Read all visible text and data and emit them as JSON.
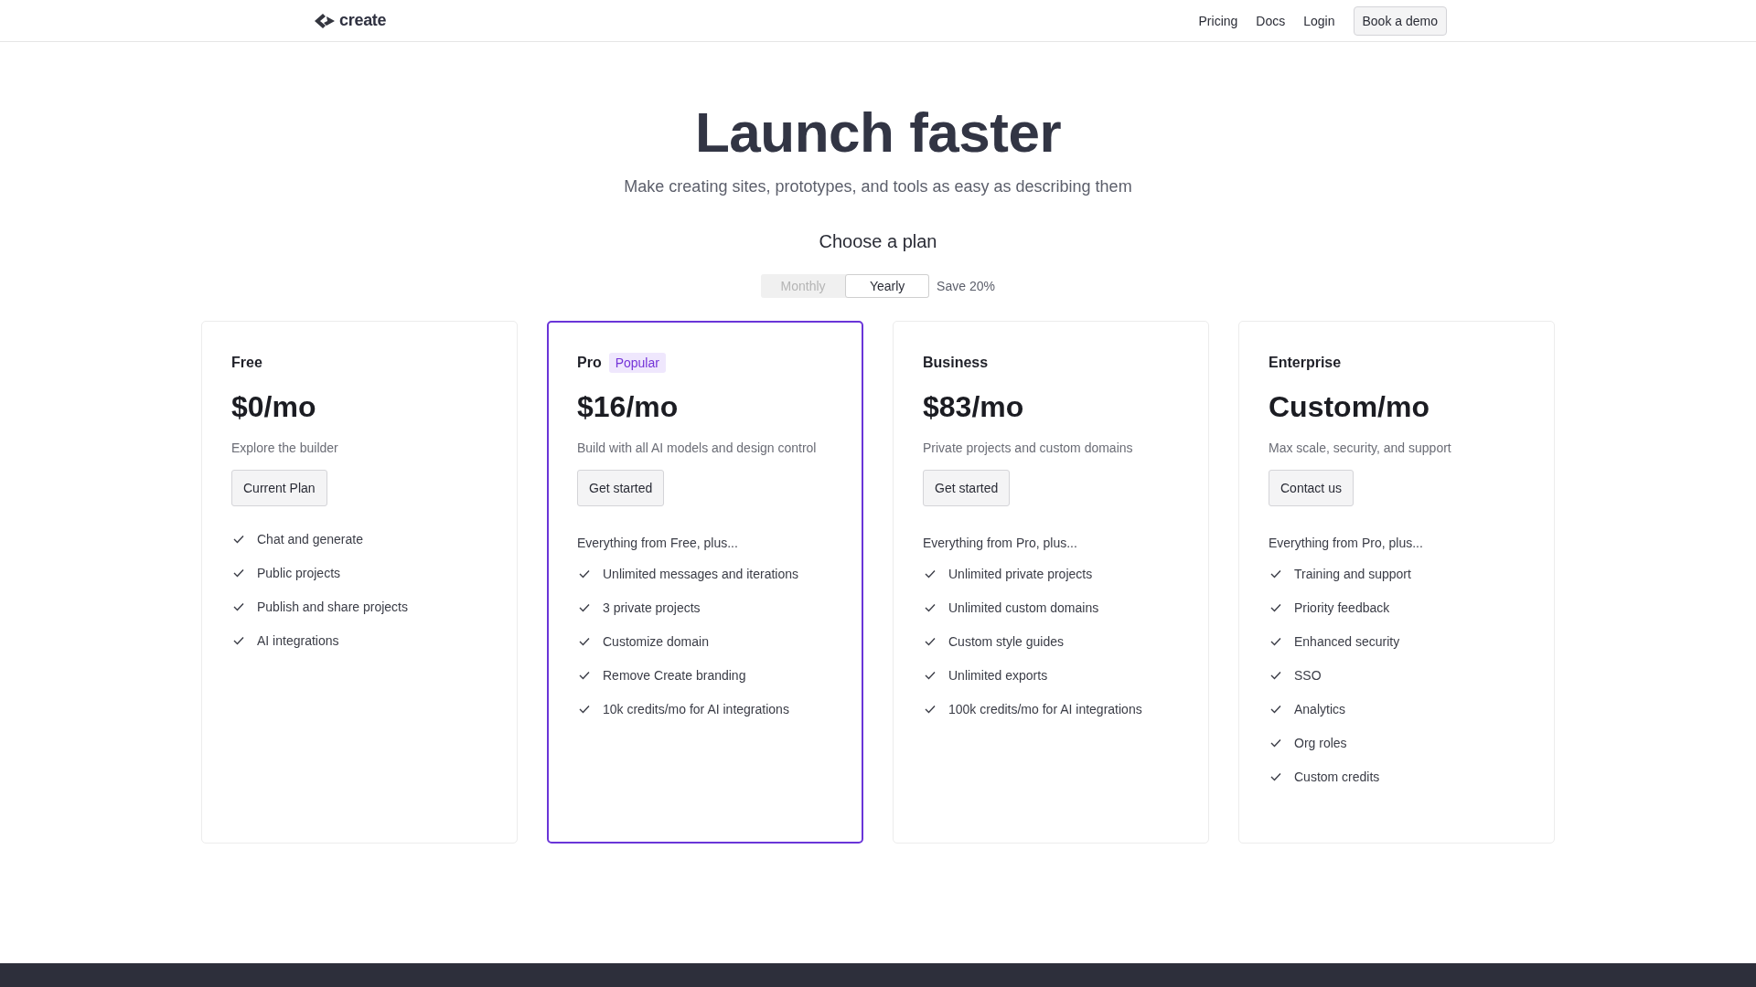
{
  "header": {
    "logo": "create",
    "nav": [
      {
        "label": "Pricing",
        "kind": "link"
      },
      {
        "label": "Docs",
        "kind": "link"
      },
      {
        "label": "Login",
        "kind": "link"
      },
      {
        "label": "Book a demo",
        "kind": "button"
      }
    ]
  },
  "hero": {
    "title": "Launch faster",
    "subtitle": "Make creating sites, prototypes, and tools as easy as describing them"
  },
  "plan_heading": "Choose a plan",
  "billing": {
    "options": [
      {
        "label": "Monthly",
        "selected": false
      },
      {
        "label": "Yearly",
        "selected": true
      }
    ],
    "note": "Save 20%"
  },
  "plans": [
    {
      "name": "Free",
      "highlighted": false,
      "price": "$0/mo",
      "description": "Explore the builder",
      "button": "Current Plan",
      "features": [
        "Chat and generate",
        "Public projects",
        "Publish and share projects",
        "AI integrations"
      ]
    },
    {
      "name": "Pro",
      "badge": "Popular",
      "highlighted": true,
      "price": "$16/mo",
      "description": "Build with all AI models and design control",
      "button": "Get started",
      "intro": "Everything from Free, plus...",
      "features": [
        "Unlimited messages and iterations",
        "3 private projects",
        "Customize domain",
        "Remove Create branding",
        "10k credits/mo for AI integrations"
      ]
    },
    {
      "name": "Business",
      "highlighted": false,
      "price": "$83/mo",
      "description": "Private projects and custom domains",
      "button": "Get started",
      "intro": "Everything from Pro, plus...",
      "features": [
        "Unlimited private projects",
        "Unlimited custom domains",
        "Custom style guides",
        "Unlimited exports",
        "100k credits/mo for AI integrations"
      ]
    },
    {
      "name": "Enterprise",
      "highlighted": false,
      "price": "Custom/mo",
      "description": "Max scale, security, and support",
      "button": "Contact us",
      "intro": "Everything from Pro, plus...",
      "features": [
        "Training and support",
        "Priority feedback",
        "Enhanced security",
        "SSO",
        "Analytics",
        "Org roles",
        "Custom credits"
      ]
    }
  ]
}
